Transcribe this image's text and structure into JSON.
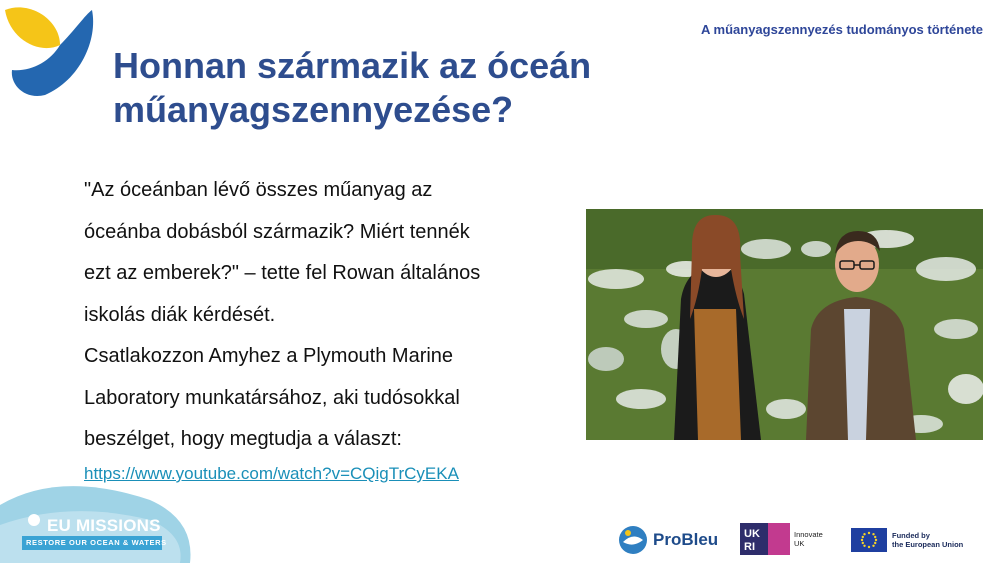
{
  "header": {
    "topic": "A műanyagszennyezés tudományos története",
    "title_line1": "Honnan származik az óceán",
    "title_line2": "műanyagszennyezése?"
  },
  "content": {
    "paragraph1_lines": [
      "\"Az óceánban lévő összes műanyag az",
      "óceánba dobásból származik? Miért tennék",
      "ezt az emberek?\" – tette fel Rowan általános",
      "iskolás diák kérdését."
    ],
    "paragraph2_lines": [
      "Csatlakozzon Amyhez a Plymouth Marine",
      "Laboratory munkatársához, aki tudósokkal",
      "beszélget, hogy megtudja a választ:"
    ],
    "link": "https://www.youtube.com/watch?v=CQigTrCyEKA"
  },
  "footer": {
    "eu_missions": "EU MISSIONS",
    "eu_missions_sub": "RESTORE OUR OCEAN & WATERS",
    "probleu": "ProBleu",
    "ukri_line1": "Innovate",
    "ukri_line2": "UK",
    "funded_line1": "Funded by",
    "funded_line2": "the European Union"
  },
  "colors": {
    "title": "#2e4d8e",
    "link": "#1a8fb8",
    "logo_yellow": "#f5c518",
    "logo_blue": "#2467b0"
  }
}
